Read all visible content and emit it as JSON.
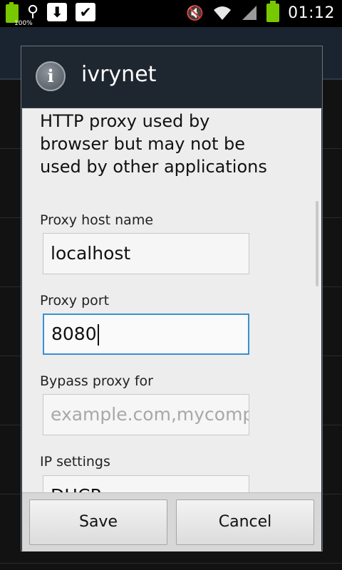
{
  "status_bar": {
    "battery_small_text": "100%",
    "time": "01:12"
  },
  "dialog": {
    "title": "ivrynet",
    "description": "HTTP proxy used by browser but may not be used by other applications",
    "proxy_host": {
      "label": "Proxy host name",
      "value": "localhost"
    },
    "proxy_port": {
      "label": "Proxy port",
      "value": "8080"
    },
    "bypass": {
      "label": "Bypass proxy for",
      "placeholder": "example.com,mycomp"
    },
    "ip_settings": {
      "label": "IP settings",
      "value": "DHCP"
    },
    "buttons": {
      "save": "Save",
      "cancel": "Cancel"
    }
  }
}
